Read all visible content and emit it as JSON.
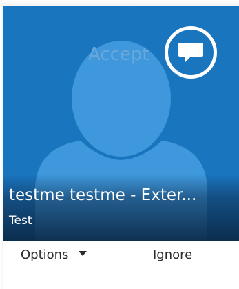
{
  "call": {
    "accept_label": "Accept",
    "caller_name": "testme testme - Exter...",
    "caller_subtitle": "Test",
    "chat_icon": "chat-bubble-icon"
  },
  "actions": {
    "options_label": "Options",
    "ignore_label": "Ignore"
  },
  "colors": {
    "panel_background": "#1a75bf",
    "avatar_silhouette": "#3f98dc",
    "accept_text": "#6aa7db",
    "footer_text": "#2b2b2b"
  }
}
